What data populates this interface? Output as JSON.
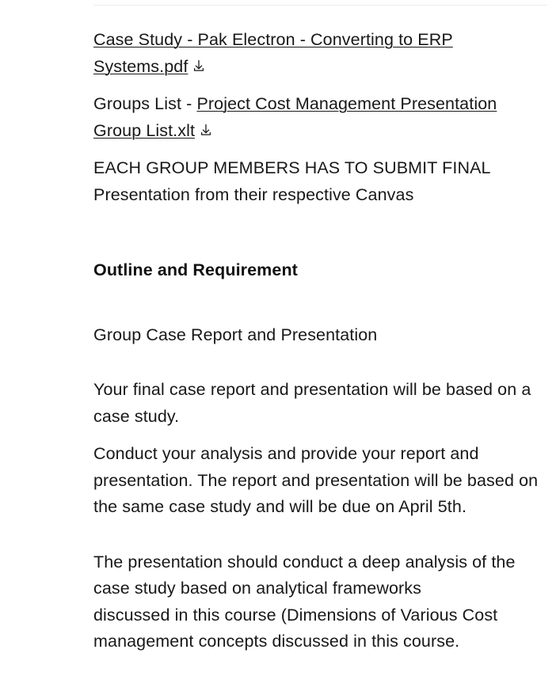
{
  "document": {
    "divider": "horizontal-rule",
    "attachments": [
      {
        "prefix": "",
        "link_text": "Case Study - Pak Electron - Converting to ERP Systems.pdf",
        "download_icon": "download-icon"
      },
      {
        "prefix": "Groups List - ",
        "link_text": "Project Cost Management Presentation Group List.xlt",
        "download_icon": "download-icon"
      }
    ],
    "notice": "EACH GROUP MEMBERS HAS TO SUBMIT FINAL Presentation from their respective Canvas",
    "heading": "Outline and Requirement",
    "subheading": "Group Case Report and Presentation",
    "paragraphs": [
      "Your final case report and presentation will be based on a case study.",
      "Conduct your analysis and provide your report and presentation. The report and presentation will be based on the same case study and will be due on April 5th.",
      "The presentation should conduct a deep analysis of the case study based on analytical frameworks\ndiscussed in this course (Dimensions of Various Cost management concepts discussed in this course."
    ]
  }
}
